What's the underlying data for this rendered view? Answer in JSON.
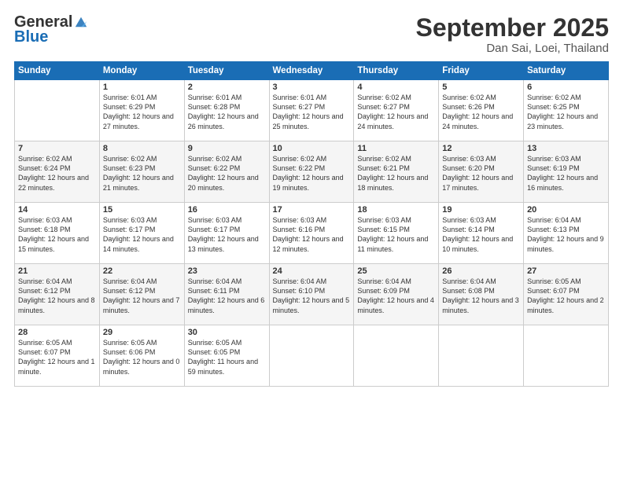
{
  "logo": {
    "general": "General",
    "blue": "Blue"
  },
  "header": {
    "month": "September 2025",
    "location": "Dan Sai, Loei, Thailand"
  },
  "weekdays": [
    "Sunday",
    "Monday",
    "Tuesday",
    "Wednesday",
    "Thursday",
    "Friday",
    "Saturday"
  ],
  "weeks": [
    [
      {
        "day": "",
        "sunrise": "",
        "sunset": "",
        "daylight": ""
      },
      {
        "day": "1",
        "sunrise": "Sunrise: 6:01 AM",
        "sunset": "Sunset: 6:29 PM",
        "daylight": "Daylight: 12 hours and 27 minutes."
      },
      {
        "day": "2",
        "sunrise": "Sunrise: 6:01 AM",
        "sunset": "Sunset: 6:28 PM",
        "daylight": "Daylight: 12 hours and 26 minutes."
      },
      {
        "day": "3",
        "sunrise": "Sunrise: 6:01 AM",
        "sunset": "Sunset: 6:27 PM",
        "daylight": "Daylight: 12 hours and 25 minutes."
      },
      {
        "day": "4",
        "sunrise": "Sunrise: 6:02 AM",
        "sunset": "Sunset: 6:27 PM",
        "daylight": "Daylight: 12 hours and 24 minutes."
      },
      {
        "day": "5",
        "sunrise": "Sunrise: 6:02 AM",
        "sunset": "Sunset: 6:26 PM",
        "daylight": "Daylight: 12 hours and 24 minutes."
      },
      {
        "day": "6",
        "sunrise": "Sunrise: 6:02 AM",
        "sunset": "Sunset: 6:25 PM",
        "daylight": "Daylight: 12 hours and 23 minutes."
      }
    ],
    [
      {
        "day": "7",
        "sunrise": "Sunrise: 6:02 AM",
        "sunset": "Sunset: 6:24 PM",
        "daylight": "Daylight: 12 hours and 22 minutes."
      },
      {
        "day": "8",
        "sunrise": "Sunrise: 6:02 AM",
        "sunset": "Sunset: 6:23 PM",
        "daylight": "Daylight: 12 hours and 21 minutes."
      },
      {
        "day": "9",
        "sunrise": "Sunrise: 6:02 AM",
        "sunset": "Sunset: 6:22 PM",
        "daylight": "Daylight: 12 hours and 20 minutes."
      },
      {
        "day": "10",
        "sunrise": "Sunrise: 6:02 AM",
        "sunset": "Sunset: 6:22 PM",
        "daylight": "Daylight: 12 hours and 19 minutes."
      },
      {
        "day": "11",
        "sunrise": "Sunrise: 6:02 AM",
        "sunset": "Sunset: 6:21 PM",
        "daylight": "Daylight: 12 hours and 18 minutes."
      },
      {
        "day": "12",
        "sunrise": "Sunrise: 6:03 AM",
        "sunset": "Sunset: 6:20 PM",
        "daylight": "Daylight: 12 hours and 17 minutes."
      },
      {
        "day": "13",
        "sunrise": "Sunrise: 6:03 AM",
        "sunset": "Sunset: 6:19 PM",
        "daylight": "Daylight: 12 hours and 16 minutes."
      }
    ],
    [
      {
        "day": "14",
        "sunrise": "Sunrise: 6:03 AM",
        "sunset": "Sunset: 6:18 PM",
        "daylight": "Daylight: 12 hours and 15 minutes."
      },
      {
        "day": "15",
        "sunrise": "Sunrise: 6:03 AM",
        "sunset": "Sunset: 6:17 PM",
        "daylight": "Daylight: 12 hours and 14 minutes."
      },
      {
        "day": "16",
        "sunrise": "Sunrise: 6:03 AM",
        "sunset": "Sunset: 6:17 PM",
        "daylight": "Daylight: 12 hours and 13 minutes."
      },
      {
        "day": "17",
        "sunrise": "Sunrise: 6:03 AM",
        "sunset": "Sunset: 6:16 PM",
        "daylight": "Daylight: 12 hours and 12 minutes."
      },
      {
        "day": "18",
        "sunrise": "Sunrise: 6:03 AM",
        "sunset": "Sunset: 6:15 PM",
        "daylight": "Daylight: 12 hours and 11 minutes."
      },
      {
        "day": "19",
        "sunrise": "Sunrise: 6:03 AM",
        "sunset": "Sunset: 6:14 PM",
        "daylight": "Daylight: 12 hours and 10 minutes."
      },
      {
        "day": "20",
        "sunrise": "Sunrise: 6:04 AM",
        "sunset": "Sunset: 6:13 PM",
        "daylight": "Daylight: 12 hours and 9 minutes."
      }
    ],
    [
      {
        "day": "21",
        "sunrise": "Sunrise: 6:04 AM",
        "sunset": "Sunset: 6:12 PM",
        "daylight": "Daylight: 12 hours and 8 minutes."
      },
      {
        "day": "22",
        "sunrise": "Sunrise: 6:04 AM",
        "sunset": "Sunset: 6:12 PM",
        "daylight": "Daylight: 12 hours and 7 minutes."
      },
      {
        "day": "23",
        "sunrise": "Sunrise: 6:04 AM",
        "sunset": "Sunset: 6:11 PM",
        "daylight": "Daylight: 12 hours and 6 minutes."
      },
      {
        "day": "24",
        "sunrise": "Sunrise: 6:04 AM",
        "sunset": "Sunset: 6:10 PM",
        "daylight": "Daylight: 12 hours and 5 minutes."
      },
      {
        "day": "25",
        "sunrise": "Sunrise: 6:04 AM",
        "sunset": "Sunset: 6:09 PM",
        "daylight": "Daylight: 12 hours and 4 minutes."
      },
      {
        "day": "26",
        "sunrise": "Sunrise: 6:04 AM",
        "sunset": "Sunset: 6:08 PM",
        "daylight": "Daylight: 12 hours and 3 minutes."
      },
      {
        "day": "27",
        "sunrise": "Sunrise: 6:05 AM",
        "sunset": "Sunset: 6:07 PM",
        "daylight": "Daylight: 12 hours and 2 minutes."
      }
    ],
    [
      {
        "day": "28",
        "sunrise": "Sunrise: 6:05 AM",
        "sunset": "Sunset: 6:07 PM",
        "daylight": "Daylight: 12 hours and 1 minute."
      },
      {
        "day": "29",
        "sunrise": "Sunrise: 6:05 AM",
        "sunset": "Sunset: 6:06 PM",
        "daylight": "Daylight: 12 hours and 0 minutes."
      },
      {
        "day": "30",
        "sunrise": "Sunrise: 6:05 AM",
        "sunset": "Sunset: 6:05 PM",
        "daylight": "Daylight: 11 hours and 59 minutes."
      },
      {
        "day": "",
        "sunrise": "",
        "sunset": "",
        "daylight": ""
      },
      {
        "day": "",
        "sunrise": "",
        "sunset": "",
        "daylight": ""
      },
      {
        "day": "",
        "sunrise": "",
        "sunset": "",
        "daylight": ""
      },
      {
        "day": "",
        "sunrise": "",
        "sunset": "",
        "daylight": ""
      }
    ]
  ]
}
